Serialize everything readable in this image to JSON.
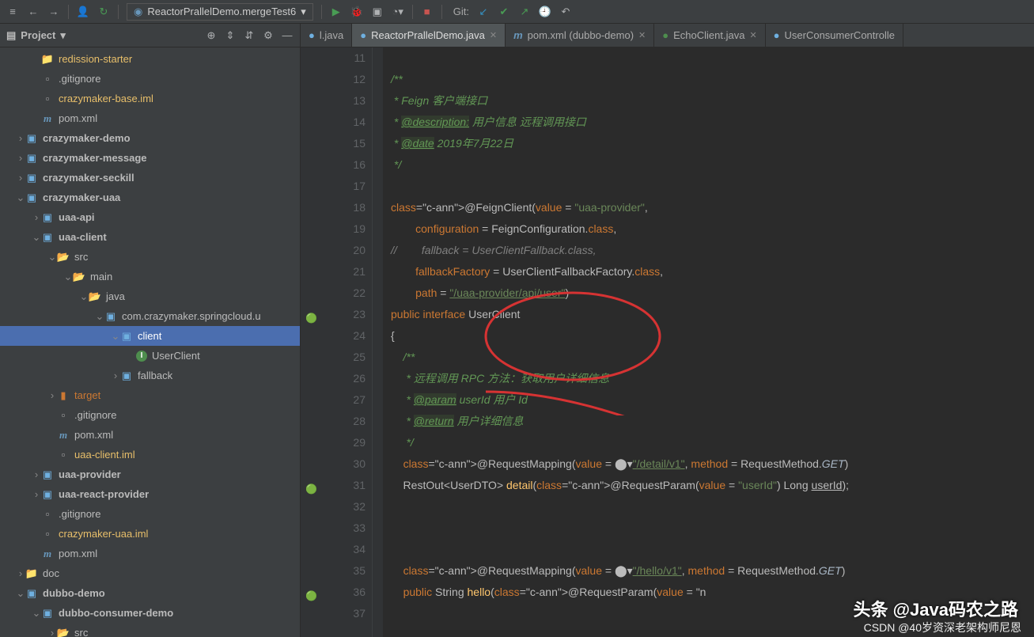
{
  "toolbar": {
    "run_config": "ReactorPrallelDemo.mergeTest6",
    "git_label": "Git:"
  },
  "sidebar": {
    "title": "Project",
    "tree": [
      {
        "depth": 2,
        "chev": "",
        "icon": "folder",
        "label": "redission-starter",
        "accent": true
      },
      {
        "depth": 2,
        "chev": "",
        "icon": "file",
        "label": ".gitignore"
      },
      {
        "depth": 2,
        "chev": "",
        "icon": "file",
        "label": "crazymaker-base.iml",
        "accent": true
      },
      {
        "depth": 2,
        "chev": "",
        "icon": "maven",
        "label": "pom.xml"
      },
      {
        "depth": 1,
        "chev": ">",
        "icon": "module",
        "label": "crazymaker-demo",
        "bold": true
      },
      {
        "depth": 1,
        "chev": ">",
        "icon": "module",
        "label": "crazymaker-message",
        "bold": true
      },
      {
        "depth": 1,
        "chev": ">",
        "icon": "module",
        "label": "crazymaker-seckill",
        "bold": true
      },
      {
        "depth": 1,
        "chev": "v",
        "icon": "module",
        "label": "crazymaker-uaa",
        "bold": true
      },
      {
        "depth": 2,
        "chev": ">",
        "icon": "module",
        "label": "uaa-api",
        "bold": true
      },
      {
        "depth": 2,
        "chev": "v",
        "icon": "module",
        "label": "uaa-client",
        "bold": true
      },
      {
        "depth": 3,
        "chev": "v",
        "icon": "folder-open",
        "label": "src"
      },
      {
        "depth": 4,
        "chev": "v",
        "icon": "folder-open",
        "label": "main"
      },
      {
        "depth": 5,
        "chev": "v",
        "icon": "folder-open",
        "label": "java"
      },
      {
        "depth": 6,
        "chev": "v",
        "icon": "package",
        "label": "com.crazymaker.springcloud.u"
      },
      {
        "depth": 7,
        "chev": "v",
        "icon": "package",
        "label": "client",
        "selected": true
      },
      {
        "depth": 8,
        "chev": "",
        "icon": "interface",
        "label": "UserClient"
      },
      {
        "depth": 7,
        "chev": ">",
        "icon": "package",
        "label": "fallback"
      },
      {
        "depth": 3,
        "chev": ">",
        "icon": "target",
        "label": "target",
        "orange": true
      },
      {
        "depth": 3,
        "chev": "",
        "icon": "file",
        "label": ".gitignore"
      },
      {
        "depth": 3,
        "chev": "",
        "icon": "maven",
        "label": "pom.xml"
      },
      {
        "depth": 3,
        "chev": "",
        "icon": "file",
        "label": "uaa-client.iml",
        "accent": true
      },
      {
        "depth": 2,
        "chev": ">",
        "icon": "module",
        "label": "uaa-provider",
        "bold": true
      },
      {
        "depth": 2,
        "chev": ">",
        "icon": "module",
        "label": "uaa-react-provider",
        "bold": true
      },
      {
        "depth": 2,
        "chev": "",
        "icon": "file",
        "label": ".gitignore"
      },
      {
        "depth": 2,
        "chev": "",
        "icon": "file",
        "label": "crazymaker-uaa.iml",
        "accent": true
      },
      {
        "depth": 2,
        "chev": "",
        "icon": "maven",
        "label": "pom.xml"
      },
      {
        "depth": 1,
        "chev": ">",
        "icon": "folder",
        "label": "doc"
      },
      {
        "depth": 1,
        "chev": "v",
        "icon": "module",
        "label": "dubbo-demo",
        "bold": true
      },
      {
        "depth": 2,
        "chev": "v",
        "icon": "module",
        "label": "dubbo-consumer-demo",
        "bold": true
      },
      {
        "depth": 3,
        "chev": ">",
        "icon": "folder-open",
        "label": "src"
      }
    ]
  },
  "tabs": [
    {
      "label": "l.java",
      "icon": "java",
      "partial": true
    },
    {
      "label": "ReactorPrallelDemo.java",
      "icon": "java",
      "active": true
    },
    {
      "label": "pom.xml (dubbo-demo)",
      "icon": "maven"
    },
    {
      "label": "EchoClient.java",
      "icon": "interface"
    },
    {
      "label": "UserConsumerControlle",
      "icon": "java",
      "partial": true
    }
  ],
  "code": {
    "start": 11,
    "lines": [
      "",
      "/**",
      " * Feign 客户端接口",
      " * @description: 用户信息 远程调用接口",
      " * @date 2019年7月22日",
      " */",
      "",
      "@FeignClient(value = \"uaa-provider\",",
      "        configuration = FeignConfiguration.class,",
      "//        fallback = UserClientFallback.class,",
      "        fallbackFactory = UserClientFallbackFactory.class,",
      "        path = \"/uaa-provider/api/user\")",
      "public interface UserClient",
      "{",
      "    /**",
      "     * 远程调用 RPC 方法：获取用户详细信息",
      "     * @param userId 用户 Id",
      "     * @return 用户详细信息",
      "     */",
      "    @RequestMapping(value = ⬤▾\"/detail/v1\", method = RequestMethod.GET)",
      "    RestOut<UserDTO> detail(@RequestParam(value = \"userId\") Long userId);",
      "",
      "",
      "",
      "    @RequestMapping(value = ⬤▾\"/hello/v1\", method = RequestMethod.GET)",
      "    public String hello(@RequestParam(value = \"n",
      ""
    ]
  },
  "watermark": "头条 @Java码农之路",
  "watermark2": "CSDN @40岁资深老架构师尼恩"
}
